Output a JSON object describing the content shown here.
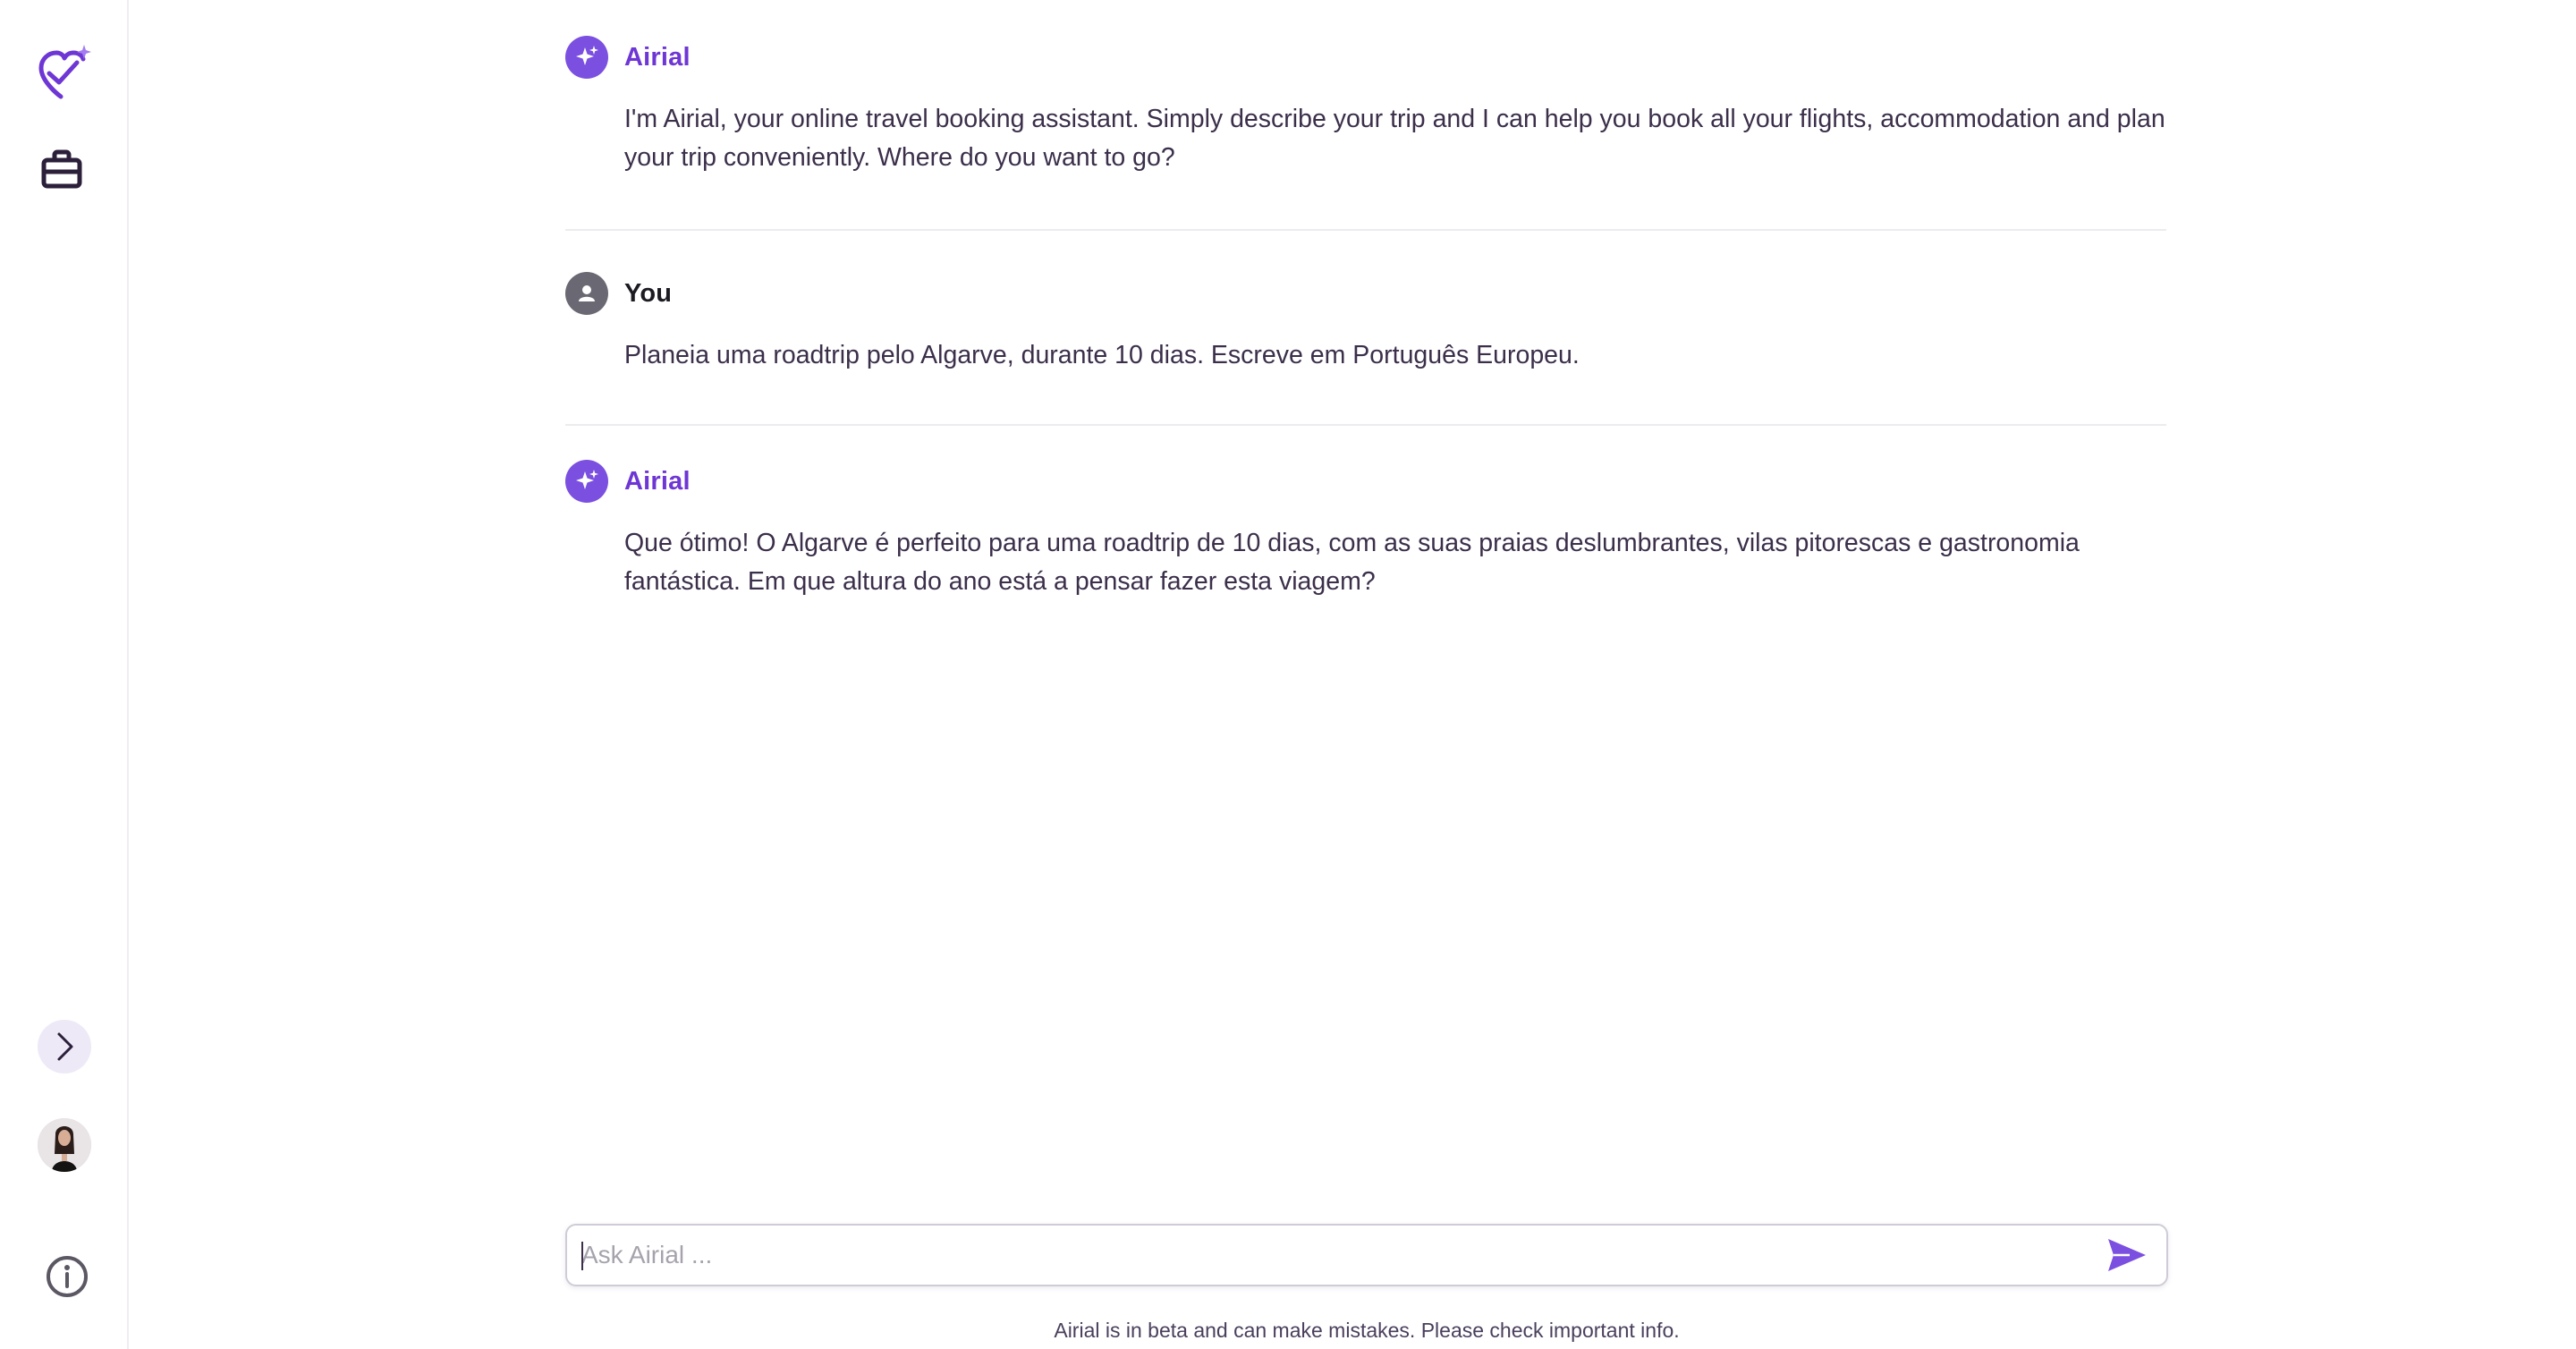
{
  "colors": {
    "accent": "#7b4fe0",
    "accent_text": "#6e36d4",
    "body_text": "#3b2f4a",
    "user_avatar": "#6a6872",
    "divider": "#ecebef"
  },
  "sidebar": {
    "logo_icon": "heart-check-sparkle-icon",
    "trips_icon": "briefcase-icon",
    "expand_icon": "chevron-right-icon",
    "avatar_icon": "user-photo-avatar",
    "info_icon": "info-circle-icon"
  },
  "messages": [
    {
      "sender": "Airial",
      "role": "ai",
      "icon": "sparkle-icon",
      "text": "I'm Airial, your online travel booking assistant. Simply describe your trip and I can help you book all your flights, accommodation and plan your trip conveniently. Where do you want to go?"
    },
    {
      "sender": "You",
      "role": "user",
      "icon": "person-icon",
      "text": "Planeia uma roadtrip pelo Algarve, durante 10 dias. Escreve em Português Europeu."
    },
    {
      "sender": "Airial",
      "role": "ai",
      "icon": "sparkle-icon",
      "text": "Que ótimo! O Algarve é perfeito para uma roadtrip de 10 dias, com as suas praias deslumbrantes, vilas pitorescas e gastronomia fantástica. Em que altura do ano está a pensar fazer esta viagem?"
    }
  ],
  "composer": {
    "placeholder": "Ask Airial ...",
    "value": "",
    "send_icon": "send-icon"
  },
  "footer": {
    "disclaimer": "Airial is in beta and can make mistakes. Please check important info."
  }
}
